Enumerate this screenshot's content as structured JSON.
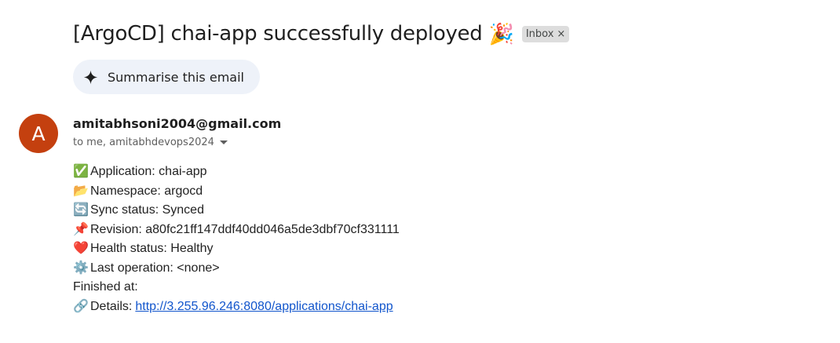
{
  "email": {
    "subject": "[ArgoCD] chai-app successfully deployed",
    "subject_emoji": "🎉",
    "label": "Inbox",
    "label_remove": "×",
    "summarise_label": "Summarise this email",
    "avatar_letter": "A",
    "sender": "amitabhsoni2004@gmail.com",
    "recipients": "to me, amitabhdevops2024"
  },
  "body": {
    "lines": [
      {
        "emoji": "✅",
        "text": "Application: chai-app"
      },
      {
        "emoji": "📂",
        "text": "Namespace: argocd"
      },
      {
        "emoji": "🔄",
        "text": "Sync status: Synced"
      },
      {
        "emoji": "📌",
        "text": "Revision: a80fc21ff147ddf40dd046a5de3dbf70cf331111"
      },
      {
        "emoji": "❤️",
        "text": "Health status: Healthy"
      },
      {
        "emoji": "⚙️",
        "text": "Last operation: <none>"
      },
      {
        "emoji": "",
        "text": "Finished at:"
      }
    ],
    "details_emoji": "🔗",
    "details_label": "Details:",
    "details_link": "http://3.255.96.246:8080/applications/chai-app"
  },
  "colors": {
    "avatar_bg": "#c4400f",
    "summarise_bg": "#eef2f9",
    "link": "#1155cc",
    "chip_bg": "#dddddd"
  }
}
